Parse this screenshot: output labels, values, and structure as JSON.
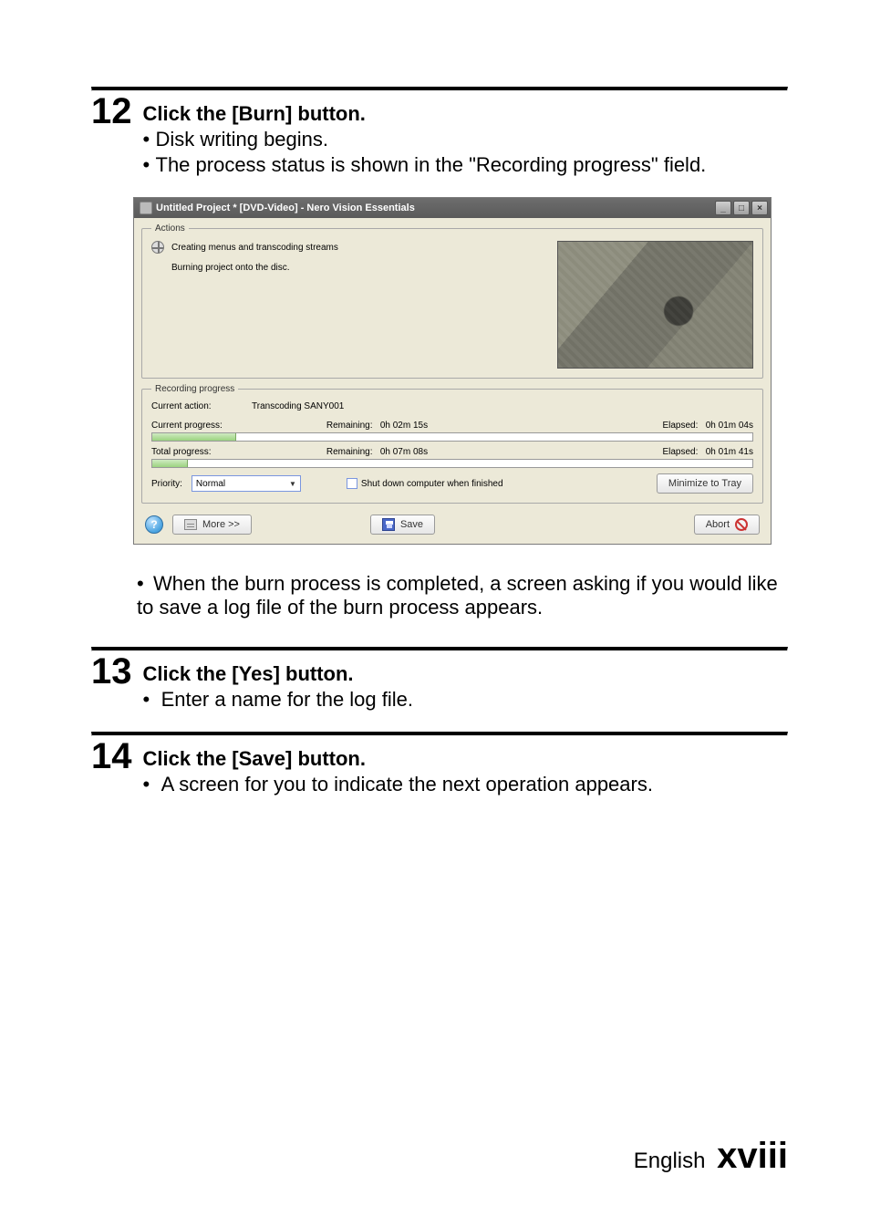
{
  "step12": {
    "number": "12",
    "title": "Click the [Burn] button.",
    "bullets": [
      "Disk writing begins.",
      "The process status is shown in the \"Recording progress\" field."
    ],
    "note": "When the burn process is completed, a screen asking if you would like to save a log file of the burn process appears."
  },
  "step13": {
    "number": "13",
    "title": "Click the [Yes] button.",
    "bullets": [
      "Enter a name for the log file."
    ]
  },
  "step14": {
    "number": "14",
    "title": "Click the [Save] button.",
    "bullets": [
      "A screen for you to indicate the next operation appears."
    ]
  },
  "footer": {
    "language": "English",
    "page_label": "xviii"
  },
  "window": {
    "title": "Untitled Project * [DVD-Video] - Nero Vision Essentials",
    "actions": {
      "legend": "Actions",
      "line1": "Creating menus and transcoding streams",
      "line2": "Burning project onto the disc."
    },
    "recording": {
      "legend": "Recording progress",
      "current_action_label": "Current action:",
      "current_action_value": "Transcoding SANY001",
      "current_progress_label": "Current progress:",
      "current_remaining_label": "Remaining:",
      "current_remaining_value": "0h 02m 15s",
      "current_elapsed_label": "Elapsed:",
      "current_elapsed_value": "0h 01m 04s",
      "current_progress_pct": 14,
      "total_progress_label": "Total progress:",
      "total_remaining_label": "Remaining:",
      "total_remaining_value": "0h 07m 08s",
      "total_elapsed_label": "Elapsed:",
      "total_elapsed_value": "0h 01m 41s",
      "total_progress_pct": 6,
      "priority_label": "Priority:",
      "priority_value": "Normal",
      "shutdown_label": "Shut down computer when finished",
      "minimize_label": "Minimize to Tray"
    },
    "bottom": {
      "more_label": "More >>",
      "save_label": "Save",
      "abort_label": "Abort"
    }
  }
}
